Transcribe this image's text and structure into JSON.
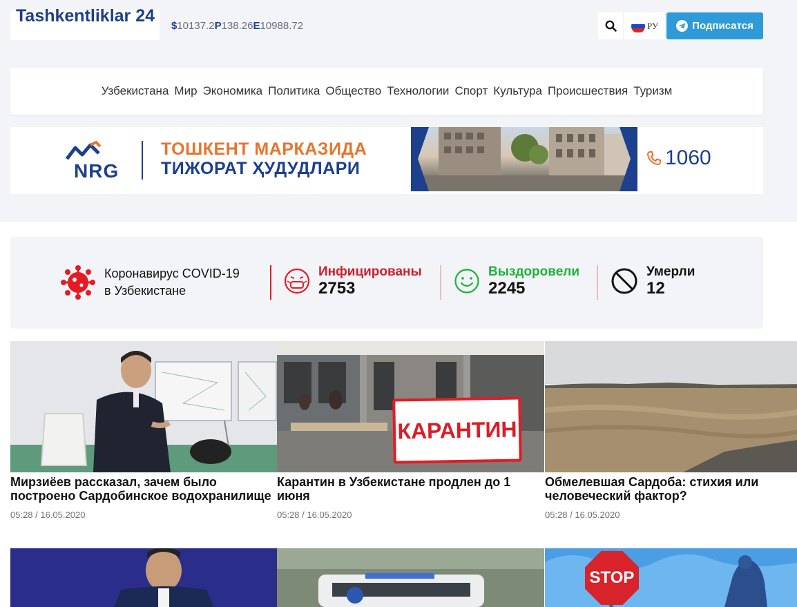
{
  "site": {
    "logo": "Tashkentliklar 24"
  },
  "rates": [
    {
      "symbol": "$",
      "value": "10137.2"
    },
    {
      "symbol": "P",
      "value": "138.26"
    },
    {
      "symbol": "E",
      "value": "10988.72"
    }
  ],
  "header": {
    "lang": "РУ",
    "subscribe": "Подписатся"
  },
  "nav": [
    "Узбекистана",
    "Мир",
    "Экономика",
    "Политика",
    "Общество",
    "Технологии",
    "Спорт",
    "Культура",
    "Происшествия",
    "Туризм"
  ],
  "banner": {
    "brand": "NRG",
    "line1": "ТОШКЕНТ МАРКАЗИДА",
    "line2": "ТИЖОРАТ ҲУДУДЛАРИ",
    "phone": "1060"
  },
  "covid": {
    "title_line1": "Коронавирус COVID-19",
    "title_line2": "в Узбекистане",
    "infected_label": "Инфицированы",
    "infected": "2753",
    "recovered_label": "Выздоровели",
    "recovered": "2245",
    "died_label": "Умерли",
    "died": "12",
    "colors": {
      "infected": "#d0202a",
      "recovered": "#1bb33a",
      "died": "#111111"
    }
  },
  "articles": [
    {
      "title": "Мирзиёев рассказал, зачем было построено Сардобинское водохранилище",
      "date": "05:28 / 16.05.2020"
    },
    {
      "title": "Карантин в Узбекистане продлен до 1 июня",
      "date": "05:28 / 16.05.2020",
      "sign": "КАРАНТИН"
    },
    {
      "title": "Обмелевшая Сардоба: стихия или человеческий фактор?",
      "date": "05:28 / 16.05.2020"
    }
  ],
  "second_row": [
    {
      "sign": ""
    },
    {
      "sign": ""
    },
    {
      "sign": "STOP"
    }
  ]
}
